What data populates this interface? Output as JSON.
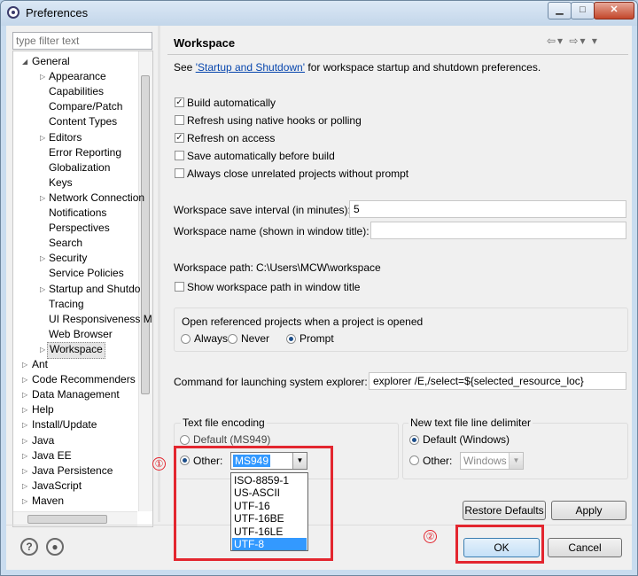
{
  "window": {
    "title": "Preferences"
  },
  "filter": {
    "placeholder": "type filter text"
  },
  "tree": [
    {
      "label": "General",
      "level": 0,
      "expanded": true
    },
    {
      "label": "Appearance",
      "level": 1,
      "arrow": true
    },
    {
      "label": "Capabilities",
      "level": 1
    },
    {
      "label": "Compare/Patch",
      "level": 1
    },
    {
      "label": "Content Types",
      "level": 1
    },
    {
      "label": "Editors",
      "level": 1,
      "arrow": true
    },
    {
      "label": "Error Reporting",
      "level": 1
    },
    {
      "label": "Globalization",
      "level": 1
    },
    {
      "label": "Keys",
      "level": 1
    },
    {
      "label": "Network Connection",
      "level": 1,
      "arrow": true
    },
    {
      "label": "Notifications",
      "level": 1
    },
    {
      "label": "Perspectives",
      "level": 1
    },
    {
      "label": "Search",
      "level": 1
    },
    {
      "label": "Security",
      "level": 1,
      "arrow": true
    },
    {
      "label": "Service Policies",
      "level": 1
    },
    {
      "label": "Startup and Shutdo",
      "level": 1,
      "arrow": true
    },
    {
      "label": "Tracing",
      "level": 1
    },
    {
      "label": "UI Responsiveness M",
      "level": 1
    },
    {
      "label": "Web Browser",
      "level": 1
    },
    {
      "label": "Workspace",
      "level": 1,
      "arrow": true,
      "selected": true
    },
    {
      "label": "Ant",
      "level": 0,
      "arrow": true
    },
    {
      "label": "Code Recommenders",
      "level": 0,
      "arrow": true
    },
    {
      "label": "Data Management",
      "level": 0,
      "arrow": true
    },
    {
      "label": "Help",
      "level": 0,
      "arrow": true
    },
    {
      "label": "Install/Update",
      "level": 0,
      "arrow": true
    },
    {
      "label": "Java",
      "level": 0,
      "arrow": true
    },
    {
      "label": "Java EE",
      "level": 0,
      "arrow": true
    },
    {
      "label": "Java Persistence",
      "level": 0,
      "arrow": true
    },
    {
      "label": "JavaScript",
      "level": 0,
      "arrow": true
    },
    {
      "label": "Maven",
      "level": 0,
      "arrow": true
    }
  ],
  "page": {
    "title": "Workspace",
    "see_prefix": "See ",
    "see_link": "'Startup and Shutdown'",
    "see_suffix": " for workspace startup and shutdown preferences.",
    "checkboxes": [
      {
        "label": "Build automatically",
        "checked": true
      },
      {
        "label": "Refresh using native hooks or polling",
        "checked": false
      },
      {
        "label": "Refresh on access",
        "checked": true
      },
      {
        "label": "Save automatically before build",
        "checked": false
      },
      {
        "label": "Always close unrelated projects without prompt",
        "checked": false
      }
    ],
    "save_interval_label": "Workspace save interval (in minutes):",
    "save_interval_value": "5",
    "ws_name_label": "Workspace name (shown in window title):",
    "ws_name_value": "",
    "ws_path_label": "Workspace path:",
    "ws_path_value": "C:\\Users\\MCW\\workspace",
    "show_path_label": "Show workspace path in window title",
    "show_path_checked": false,
    "open_ref_label": "Open referenced projects when a project is opened",
    "open_ref_options": [
      "Always",
      "Never",
      "Prompt"
    ],
    "open_ref_selected": "Prompt",
    "explorer_label": "Command for launching system explorer:",
    "explorer_value": "explorer /E,/select=${selected_resource_loc}",
    "encoding_label": "Text file encoding",
    "encoding_default": "Default (MS949)",
    "encoding_other": "Other:",
    "encoding_selected": "MS949",
    "encoding_options": [
      "ISO-8859-1",
      "US-ASCII",
      "UTF-16",
      "UTF-16BE",
      "UTF-16LE",
      "UTF-8"
    ],
    "encoding_highlight": "UTF-8",
    "delim_label": "New text file line delimiter",
    "delim_default": "Default (Windows)",
    "delim_other": "Other:",
    "delim_other_value": "Windows",
    "restore_defaults": "Restore Defaults",
    "apply": "Apply"
  },
  "footer": {
    "ok": "OK",
    "cancel": "Cancel"
  },
  "annotations": {
    "one": "①",
    "two": "②",
    "color": "#e3262f"
  }
}
